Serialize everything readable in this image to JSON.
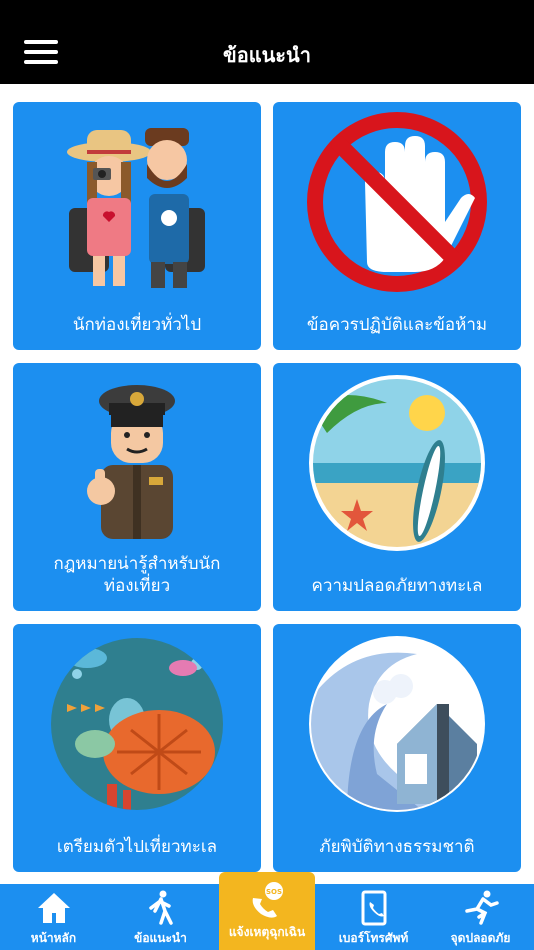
{
  "header": {
    "title": "ข้อแนะนำ",
    "menu_icon": "hamburger-menu-icon"
  },
  "cards": [
    {
      "label": "นักท่องเที่ยวทั่วไป",
      "icon": "tourists-illustration"
    },
    {
      "label": "ข้อควรปฏิบัติและข้อห้าม",
      "icon": "stop-hand-illustration"
    },
    {
      "label": "กฎหมายน่ารู้สำหรับนัก\nท่องเที่ยว",
      "icon": "police-officer-illustration"
    },
    {
      "label": "ความปลอดภัยทางทะเล",
      "icon": "beach-surfboard-illustration"
    },
    {
      "label": "เตรียมตัวไปเที่ยวทะเล",
      "icon": "sea-turtle-illustration"
    },
    {
      "label": "ภัยพิบัติทางธรรมชาติ",
      "icon": "tsunami-house-illustration"
    }
  ],
  "tabs": {
    "home": {
      "label": "หน้าหลัก",
      "icon": "home-icon"
    },
    "advice": {
      "label": "ข้อแนะนำ",
      "icon": "walking-person-icon"
    },
    "sos": {
      "label": "แจ้งเหตุฉุกเฉิน",
      "badge": "SOS",
      "icon": "sos-phone-icon"
    },
    "phone": {
      "label": "เบอร์โทรศัพท์",
      "icon": "phone-book-icon"
    },
    "safe": {
      "label": "จุดปลอดภัย",
      "icon": "running-person-icon"
    }
  },
  "colors": {
    "card_blue": "#1c8ff0",
    "header_black": "#000000",
    "sos_yellow": "#f3b61f"
  }
}
